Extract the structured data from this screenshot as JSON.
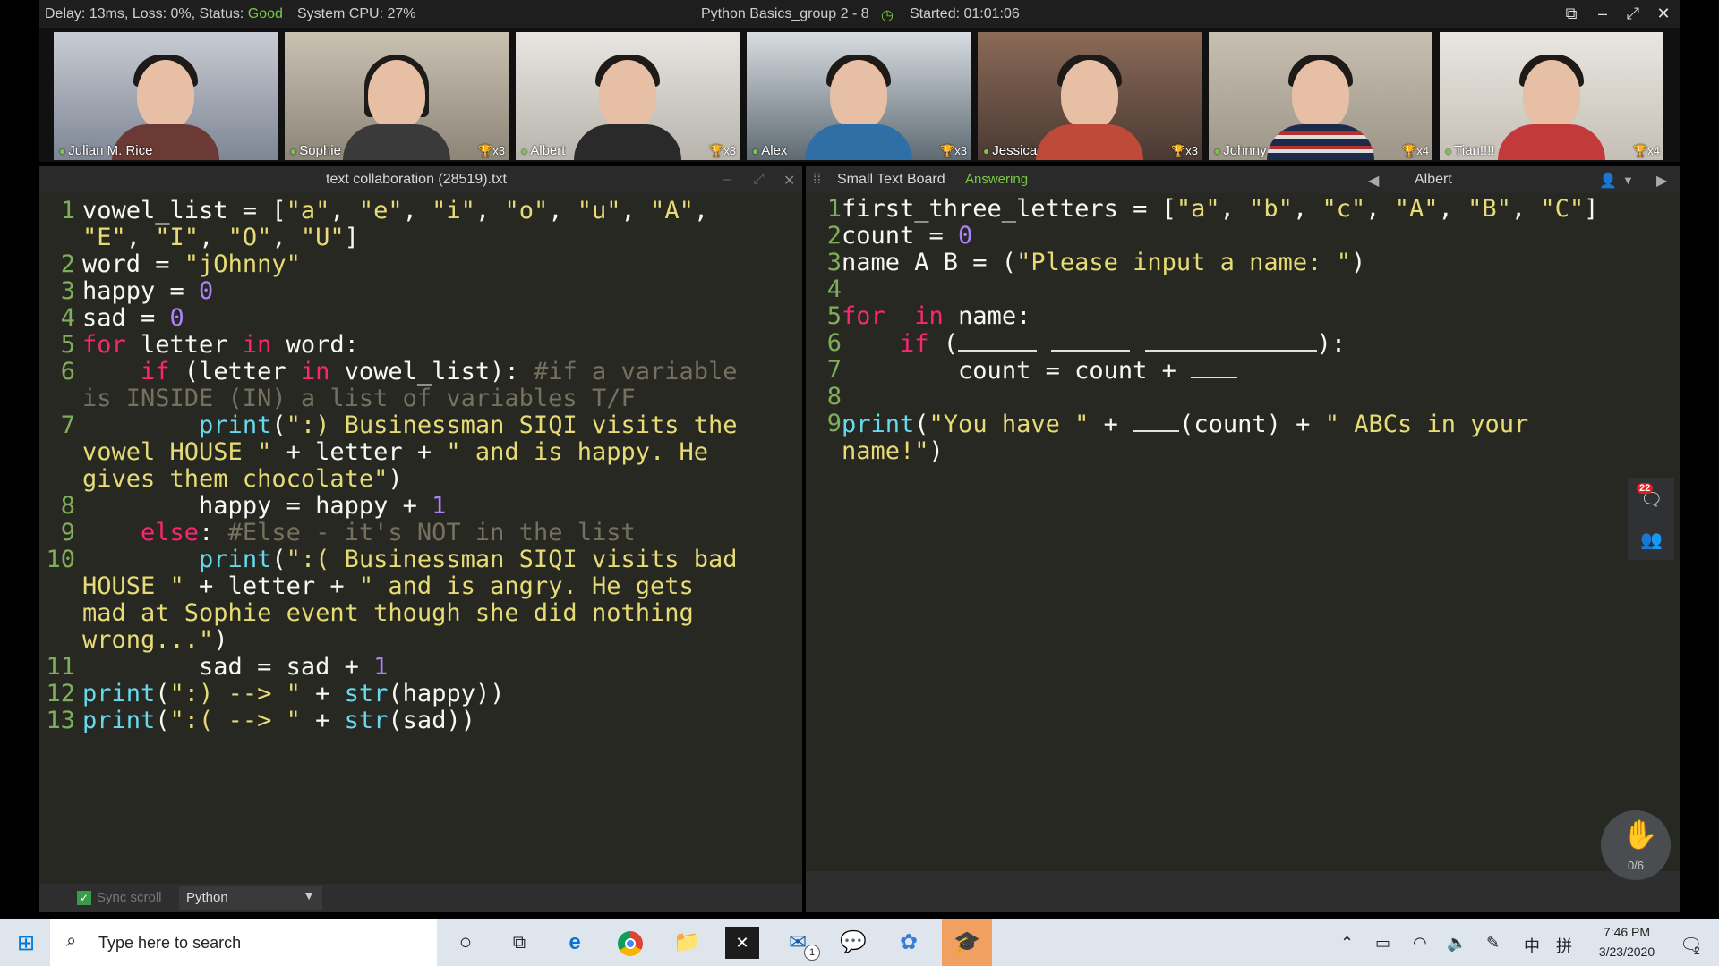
{
  "topbar": {
    "status_prefix": "Delay: 13ms, Loss: 0%, Status:",
    "status_value": "Good",
    "cpu": "System CPU: 27%",
    "title": "Python Basics_group 2 - 8",
    "started": "Started: 01:01:06"
  },
  "participants": [
    {
      "name": "Julian M. Rice",
      "trophy": ""
    },
    {
      "name": "Sophie",
      "trophy": "x3"
    },
    {
      "name": "Albert",
      "trophy": "x3"
    },
    {
      "name": "Alex",
      "trophy": "x3"
    },
    {
      "name": "Jessica",
      "trophy": "x3"
    },
    {
      "name": "Johnny",
      "trophy": "x4"
    },
    {
      "name": "Tian!!!!",
      "trophy": "x4"
    }
  ],
  "left_panel": {
    "title": "text collaboration (28519).txt",
    "sync_label": "Sync scroll",
    "language": "Python"
  },
  "right_panel": {
    "title": "Small Text Board",
    "status": "Answering",
    "student": "Albert"
  },
  "side_buttons": {
    "chat_badge": "22"
  },
  "raise_hand": {
    "count": "0/6"
  },
  "taskbar": {
    "search_placeholder": "Type here to search",
    "mail_badge": "1",
    "time": "7:46 PM",
    "date": "3/23/2020",
    "ime_lang": "中",
    "ime_mode": "拼",
    "notif_count": "2"
  },
  "colors": {
    "editor_bg": "#272822",
    "keyword": "#f92672",
    "string": "#e6db74",
    "number": "#ae81ff",
    "comment": "#75715e",
    "builtin": "#66d9ef",
    "line_number": "#7fae5a",
    "status_good": "#7ac943"
  }
}
